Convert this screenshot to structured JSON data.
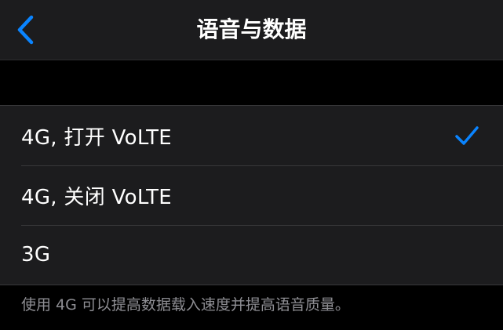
{
  "nav": {
    "title": "语音与数据",
    "back_icon": "chevron-left-icon"
  },
  "options": [
    {
      "label": "4G, 打开 VoLTE",
      "selected": true
    },
    {
      "label": "4G, 关闭 VoLTE",
      "selected": false
    },
    {
      "label": "3G",
      "selected": false
    }
  ],
  "footer": {
    "note": "使用 4G 可以提高数据载入速度并提高语音质量。"
  },
  "colors": {
    "accent": "#0a84ff",
    "background": "#000000",
    "cell": "#1c1c1e",
    "separator": "#38383a",
    "secondary_text": "#8e8e93"
  }
}
